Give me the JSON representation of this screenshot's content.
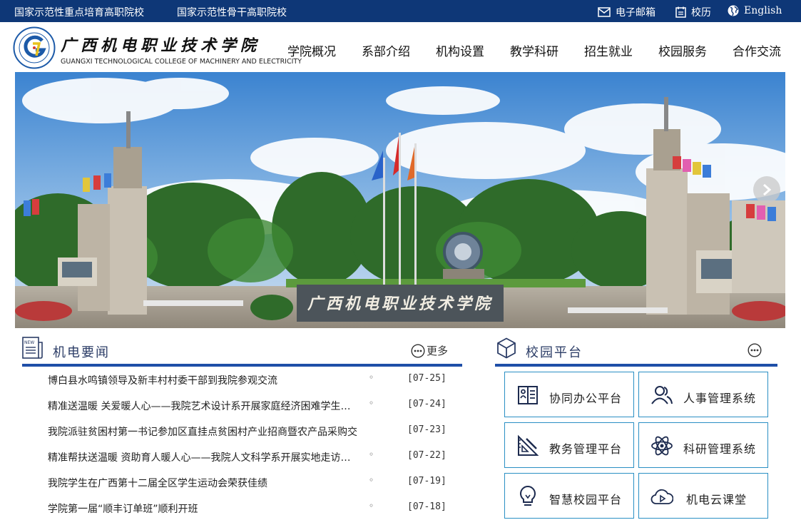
{
  "topbar": {
    "left_1": "国家示范性重点培育高职院校",
    "left_2": "国家示范性骨干高职院校",
    "email": "电子邮箱",
    "history": "校历",
    "english": "English"
  },
  "header": {
    "college_name_cn": "广西机电职业技术学院",
    "college_name_en": "GUANGXI TECHNOLOGICAL COLLEGE OF MACHINERY AND ELECTRICITY",
    "nav": [
      "学院概况",
      "系部介绍",
      "机构设置",
      "教学科研",
      "招生就业",
      "校园服务",
      "合作交流"
    ]
  },
  "banner": {
    "gate_text": "广西机电职业技术学院"
  },
  "news": {
    "title": "机电要闻",
    "more": "更多",
    "items": [
      {
        "title": "博白县水鸣镇领导及新丰村村委干部到我院参观交流",
        "date": "[07-25]"
      },
      {
        "title": "精准送温暖 关爱暖人心——我院艺术设计系开展家庭经济困难学生…",
        "date": "[07-24]"
      },
      {
        "title": "我院派驻贫困村第一书记参加区直挂点贫困村产业招商暨农产品采购交",
        "date": "[07-23]"
      },
      {
        "title": "精准帮扶送温暖 资助育人暖人心——我院人文科学系开展实地走访…",
        "date": "[07-22]"
      },
      {
        "title": "我院学生在广西第十二届全区学生运动会荣获佳绩",
        "date": "[07-19]"
      },
      {
        "title": "学院第一届“顺丰订单班”顺利开班",
        "date": "[07-18]"
      }
    ]
  },
  "platform": {
    "title": "校园平台",
    "items": [
      {
        "label": "协同办公平台",
        "icon": "office-icon"
      },
      {
        "label": "人事管理系统",
        "icon": "people-icon"
      },
      {
        "label": "教务管理平台",
        "icon": "ruler-icon"
      },
      {
        "label": "科研管理系统",
        "icon": "atom-icon"
      },
      {
        "label": "智慧校园平台",
        "icon": "lightbulb-icon"
      },
      {
        "label": "机电云课堂",
        "icon": "cloud-play-icon"
      }
    ]
  },
  "colors": {
    "topbar": "#0e3777",
    "accent_rule": "#1f4fa8",
    "platform_border": "#2a8fc4"
  }
}
